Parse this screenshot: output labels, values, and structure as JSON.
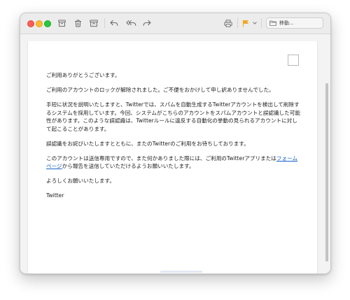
{
  "toolbar": {
    "move_label": "移動..."
  },
  "mail": {
    "paragraphs": [
      "ご利用ありがとうございます。",
      "ご利用のアカウントのロックが解除されました。ご不便をおかけして申し訳ありませんでした。",
      "手短に状況を説明いたしますと、Twitterでは、スパムを自動生成するTwitterアカウントを検出して削除するシステムを採用しています。今回、システムがこちらのアカウントをスパムアカウントと誤認識した可能性があります。このような誤認識は、Twitterルールに違反する自動化の挙動の見られるアカウントに対して起こることがあります。",
      "誤認識をお詫びいたしますとともに、またのTwitterのご利用をお待ちしております。"
    ],
    "account_note_before": "このアカウントは送信専用ですので、また何かありました際には、ご利用のTwitterアプリまたは",
    "account_note_link": "フォームページ",
    "account_note_after": "から報告を送信していただけるようお願いいたします。",
    "closing": "よろしくお願いいたします。",
    "signature": "Twitter"
  },
  "colors": {
    "close": "#fe5f57",
    "minimize": "#febc2e",
    "zoom": "#28c840",
    "flag": "#f5a623",
    "link": "#1a64c9"
  },
  "icons": [
    "archive-icon",
    "trash-icon",
    "junk-icon",
    "reply-icon",
    "reply-all-icon",
    "forward-icon",
    "print-icon",
    "flag-icon",
    "chevron-down-icon",
    "folder-icon"
  ]
}
